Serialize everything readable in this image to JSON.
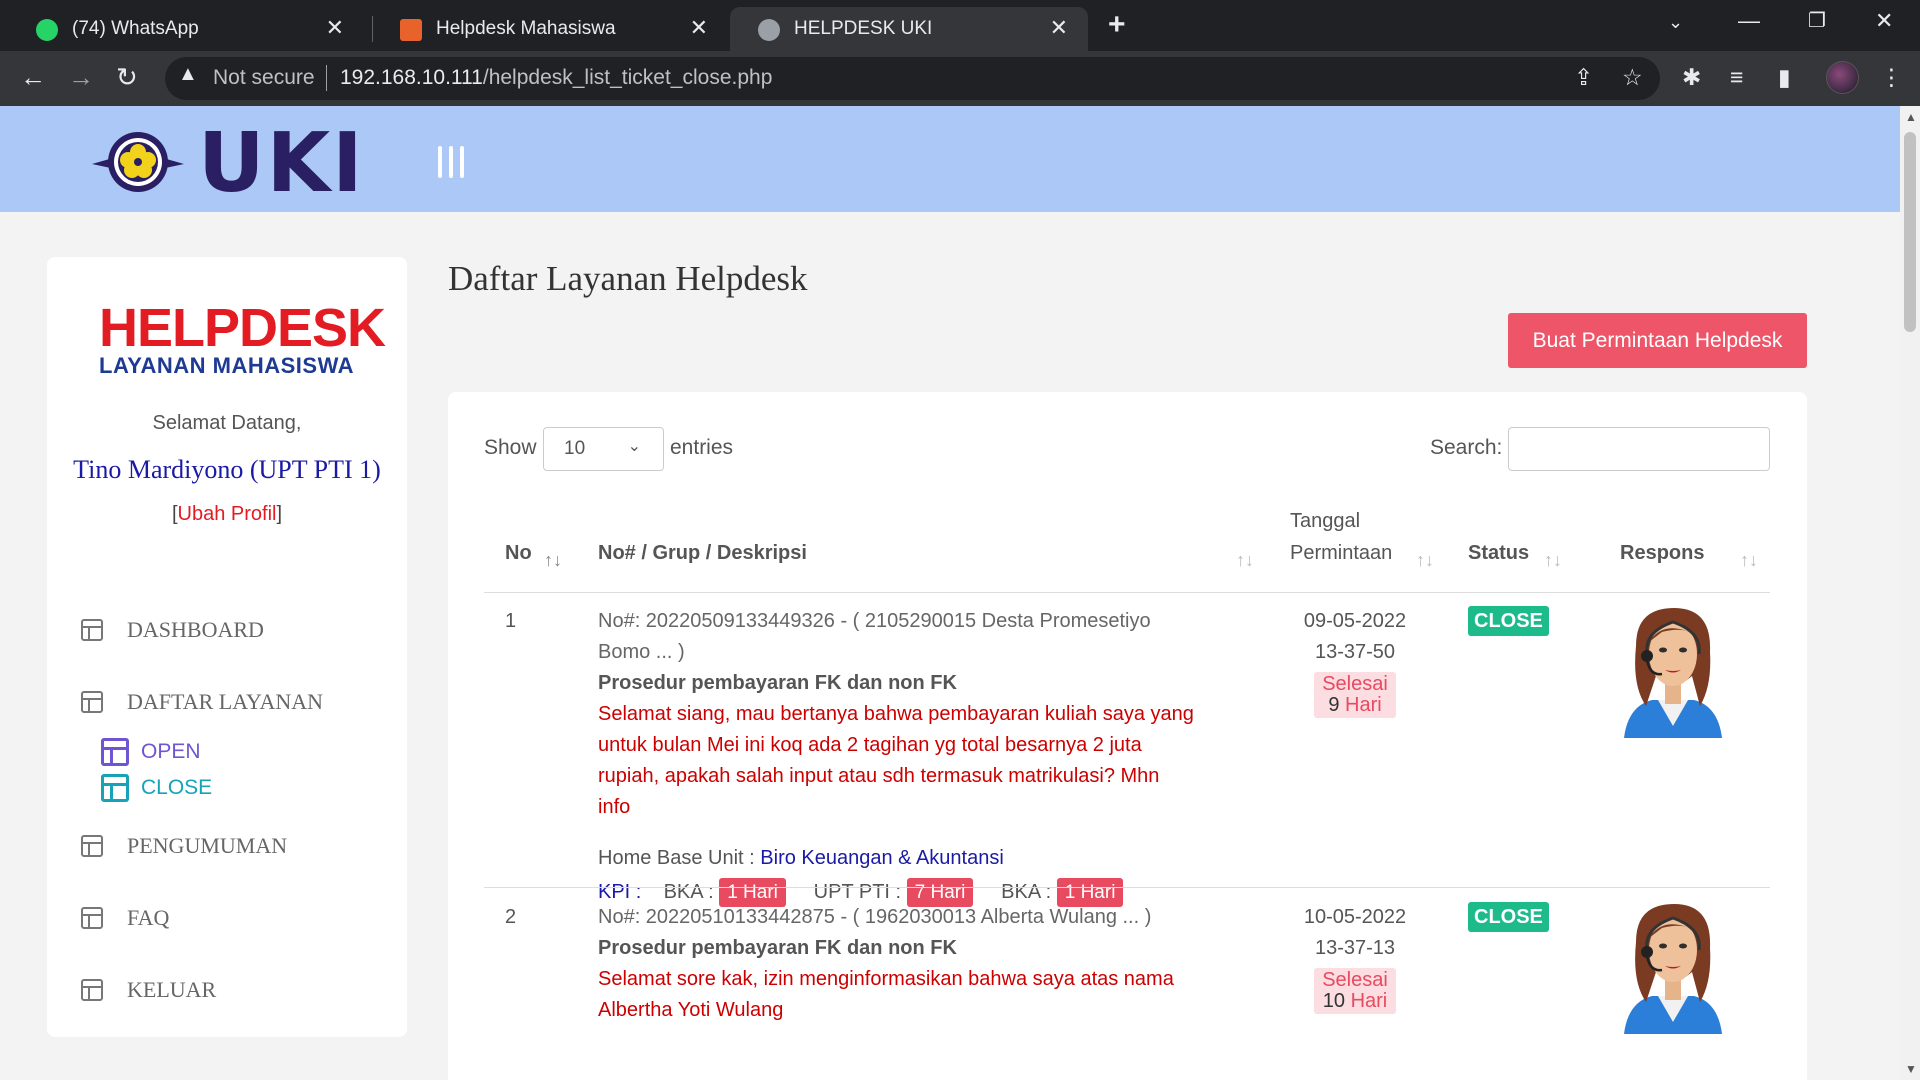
{
  "browser": {
    "tabs": [
      {
        "label": "(74) WhatsApp",
        "badge": "74"
      },
      {
        "label": "Helpdesk Mahasiswa"
      },
      {
        "label": "HELPDESK UKI"
      }
    ],
    "security_text": "Not secure",
    "url_host": "192.168.10.111",
    "url_path": "/helpdesk_list_ticket_close.php"
  },
  "header": {
    "logo_text": "UKI"
  },
  "sidebar": {
    "brand_title": "HELPDESK",
    "brand_subtitle": "LAYANAN MAHASISWA",
    "welcome": "Selamat Datang,",
    "username": "Tino Mardiyono (UPT PTI 1)",
    "profile_link": "Ubah Profil",
    "menu": {
      "dashboard": "DASHBOARD",
      "daftar_layanan": "DAFTAR LAYANAN",
      "open": "OPEN",
      "close": "CLOSE",
      "pengumuman": "PENGUMUMAN",
      "faq": "FAQ",
      "keluar": "KELUAR"
    }
  },
  "main": {
    "title": "Daftar Layanan Helpdesk",
    "create_button": "Buat Permintaan Helpdesk",
    "show_label": "Show",
    "show_value": "10",
    "entries_label": "entries",
    "search_label": "Search:",
    "search_value": "",
    "columns": {
      "no": "No",
      "desc": "No# / Grup / Deskripsi",
      "date_line1": "Tanggal",
      "date_line2": "Permintaan",
      "status": "Status",
      "respons": "Respons"
    },
    "rows": [
      {
        "no": "1",
        "ticket_line1": "No#: 20220509133449326 - ( 2105290015 Desta Promesetiyo",
        "ticket_line2": "Bomo ... )",
        "group": "Prosedur pembayaran FK dan non FK",
        "desc_lines": [
          "Selamat siang, mau bertanya bahwa pembayaran kuliah saya yang",
          "untuk bulan Mei ini koq ada 2 tagihan yg total besarnya 2 juta",
          "rupiah, apakah salah input atau sdh termasuk matrikulasi? Mhn",
          "info"
        ],
        "home_base_label": "Home Base Unit :",
        "home_base_value": "Biro Keuangan & Akuntansi",
        "kpi_label": "KPI :",
        "kpi": [
          {
            "unit": "BKA :",
            "days": "1 Hari"
          },
          {
            "unit": "UPT PTI :",
            "days": "7 Hari"
          },
          {
            "unit": "BKA :",
            "days": "1 Hari"
          }
        ],
        "date": "09-05-2022",
        "time": "13-37-50",
        "selesai_label": "Selesai",
        "selesai_num": "9",
        "selesai_unit": "Hari",
        "status": "CLOSE"
      },
      {
        "no": "2",
        "ticket_line1": "No#: 20220510133442875 - ( 1962030013 Alberta Wulang ... )",
        "group": "Prosedur pembayaran FK dan non FK",
        "desc_line1": "Selamat sore kak, izin menginformasikan bahwa saya atas nama",
        "desc_line2": "Albertha Yoti Wulang",
        "date": "10-05-2022",
        "time": "13-37-13",
        "selesai_label": "Selesai",
        "selesai_num": "10",
        "selesai_unit": "Hari",
        "status": "CLOSE"
      }
    ]
  },
  "colors": {
    "header_bg": "#abc8f7",
    "accent_red": "#ef5568",
    "status_green": "#1dba8a",
    "link_blue": "#1a1aa6"
  }
}
